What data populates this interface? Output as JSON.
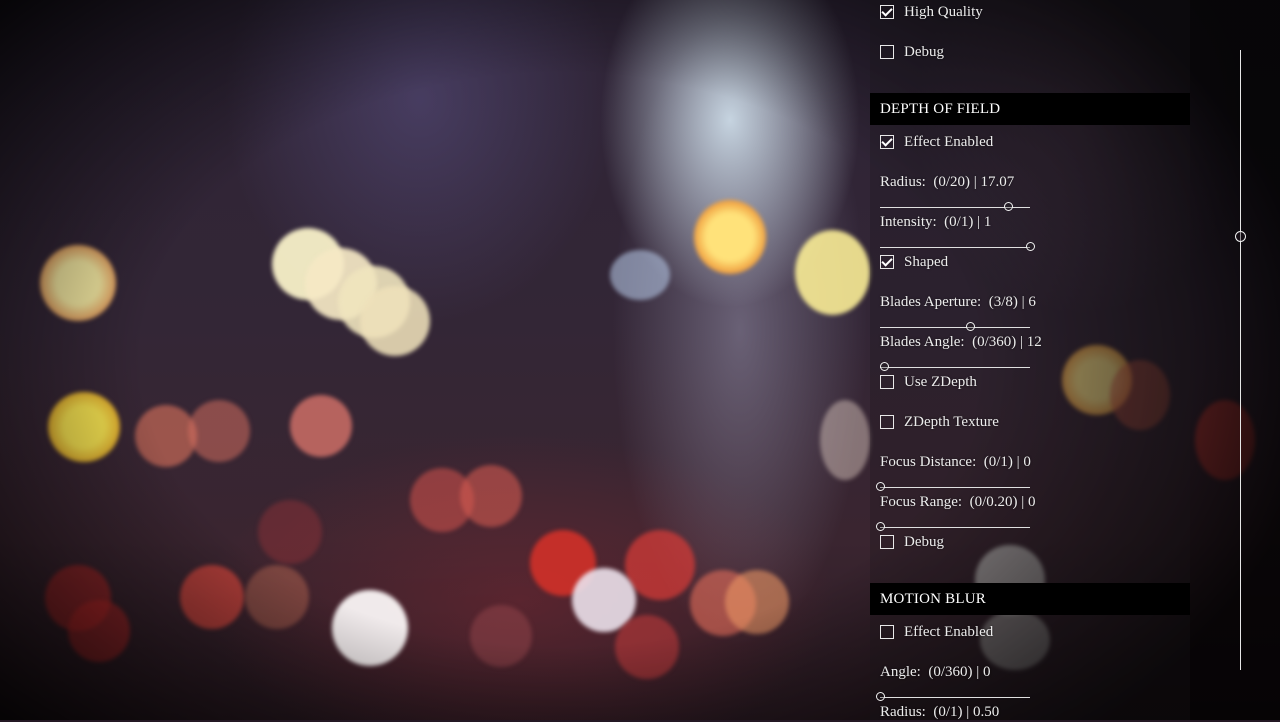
{
  "top_section": {
    "high_quality": {
      "label": "High Quality",
      "checked": true
    },
    "debug": {
      "label": "Debug",
      "checked": false
    }
  },
  "depth_of_field": {
    "title": "DEPTH OF FIELD",
    "effect_enabled": {
      "label": "Effect Enabled",
      "checked": true
    },
    "radius": {
      "label": "Radius:",
      "range": "(0/20)",
      "value": "17.07",
      "fraction": 0.8535
    },
    "intensity": {
      "label": "Intensity:",
      "range": "(0/1)",
      "value": "1",
      "fraction": 1.0
    },
    "shaped": {
      "label": "Shaped",
      "checked": true
    },
    "blades_aperture": {
      "label": "Blades Aperture:",
      "range": "(3/8)",
      "value": "6",
      "fraction": 0.6
    },
    "blades_angle": {
      "label": "Blades Angle:",
      "range": "(0/360)",
      "value": "12",
      "fraction": 0.033
    },
    "use_zdepth": {
      "label": "Use ZDepth",
      "checked": false
    },
    "zdepth_texture": {
      "label": "ZDepth Texture",
      "checked": false
    },
    "focus_distance": {
      "label": "Focus Distance:",
      "range": "(0/1)",
      "value": "0",
      "fraction": 0.0
    },
    "focus_range": {
      "label": "Focus Range:",
      "range": "(0/0.20)",
      "value": "0",
      "fraction": 0.0
    },
    "debug": {
      "label": "Debug",
      "checked": false
    }
  },
  "motion_blur": {
    "title": "MOTION BLUR",
    "effect_enabled": {
      "label": "Effect Enabled",
      "checked": false
    },
    "angle": {
      "label": "Angle:",
      "range": "(0/360)",
      "value": "0",
      "fraction": 0.0
    },
    "radius": {
      "label": "Radius:",
      "range": "(0/1)",
      "value": "0.50",
      "fraction": 0.5
    }
  },
  "scrollbar": {
    "position": 0.3
  }
}
